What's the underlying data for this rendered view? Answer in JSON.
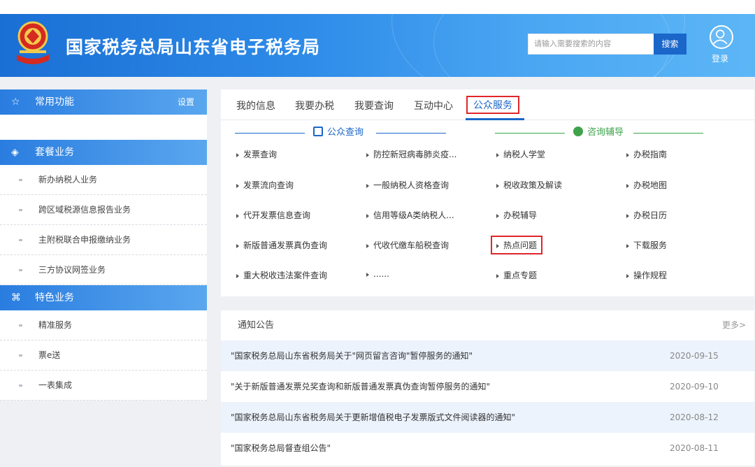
{
  "header": {
    "title": "国家税务总局山东省电子税务局",
    "search_placeholder": "请输入需要搜索的内容",
    "search_button": "搜索",
    "login": "登录"
  },
  "sidebar": {
    "common": {
      "label": "常用功能",
      "setting": "设置"
    },
    "package": {
      "label": "套餐业务",
      "items": [
        "新办纳税人业务",
        "跨区域税源信息报告业务",
        "主附税联合申报缴纳业务",
        "三方协议网签业务"
      ]
    },
    "special": {
      "label": "特色业务",
      "items": [
        "精准服务",
        "票e送",
        "一表集成"
      ]
    }
  },
  "tabs": [
    "我的信息",
    "我要办税",
    "我要查询",
    "互动中心",
    "公众服务"
  ],
  "active_tab": "公众服务",
  "public_query": {
    "title": "公众查询",
    "col1": [
      "发票查询",
      "发票流向查询",
      "代开发票信息查询",
      "新版普通发票真伪查询",
      "重大税收违法案件查询"
    ],
    "col2": [
      "防控新冠病毒肺炎疫...",
      "一般纳税人资格查询",
      "信用等级A类纳税人...",
      "代收代缴车船税查询",
      "......"
    ]
  },
  "consult": {
    "title": "咨询辅导",
    "col1": [
      "纳税人学堂",
      "税收政策及解读",
      "办税辅导",
      "热点问题",
      "重点专题"
    ],
    "col2": [
      "办税指南",
      "办税地图",
      "办税日历",
      "下载服务",
      "操作规程"
    ]
  },
  "notice": {
    "title": "通知公告",
    "more": "更多>",
    "rows": [
      {
        "text": "\"国家税务总局山东省税务局关于\"网页留言咨询\"暂停服务的通知\"",
        "date": "2020-09-15"
      },
      {
        "text": "\"关于新版普通发票兑奖查询和新版普通发票真伪查询暂停服务的通知\"",
        "date": "2020-09-10"
      },
      {
        "text": "\"国家税务总局山东省税务局关于更新增值税电子发票版式文件阅读器的通知\"",
        "date": "2020-08-12"
      },
      {
        "text": "\"国家税务总局督查组公告\"",
        "date": "2020-08-11"
      }
    ]
  },
  "colors": {
    "brand_blue": "#1b66c9",
    "highlight_red": "#e0262a",
    "consult_green": "#3fa34d"
  }
}
